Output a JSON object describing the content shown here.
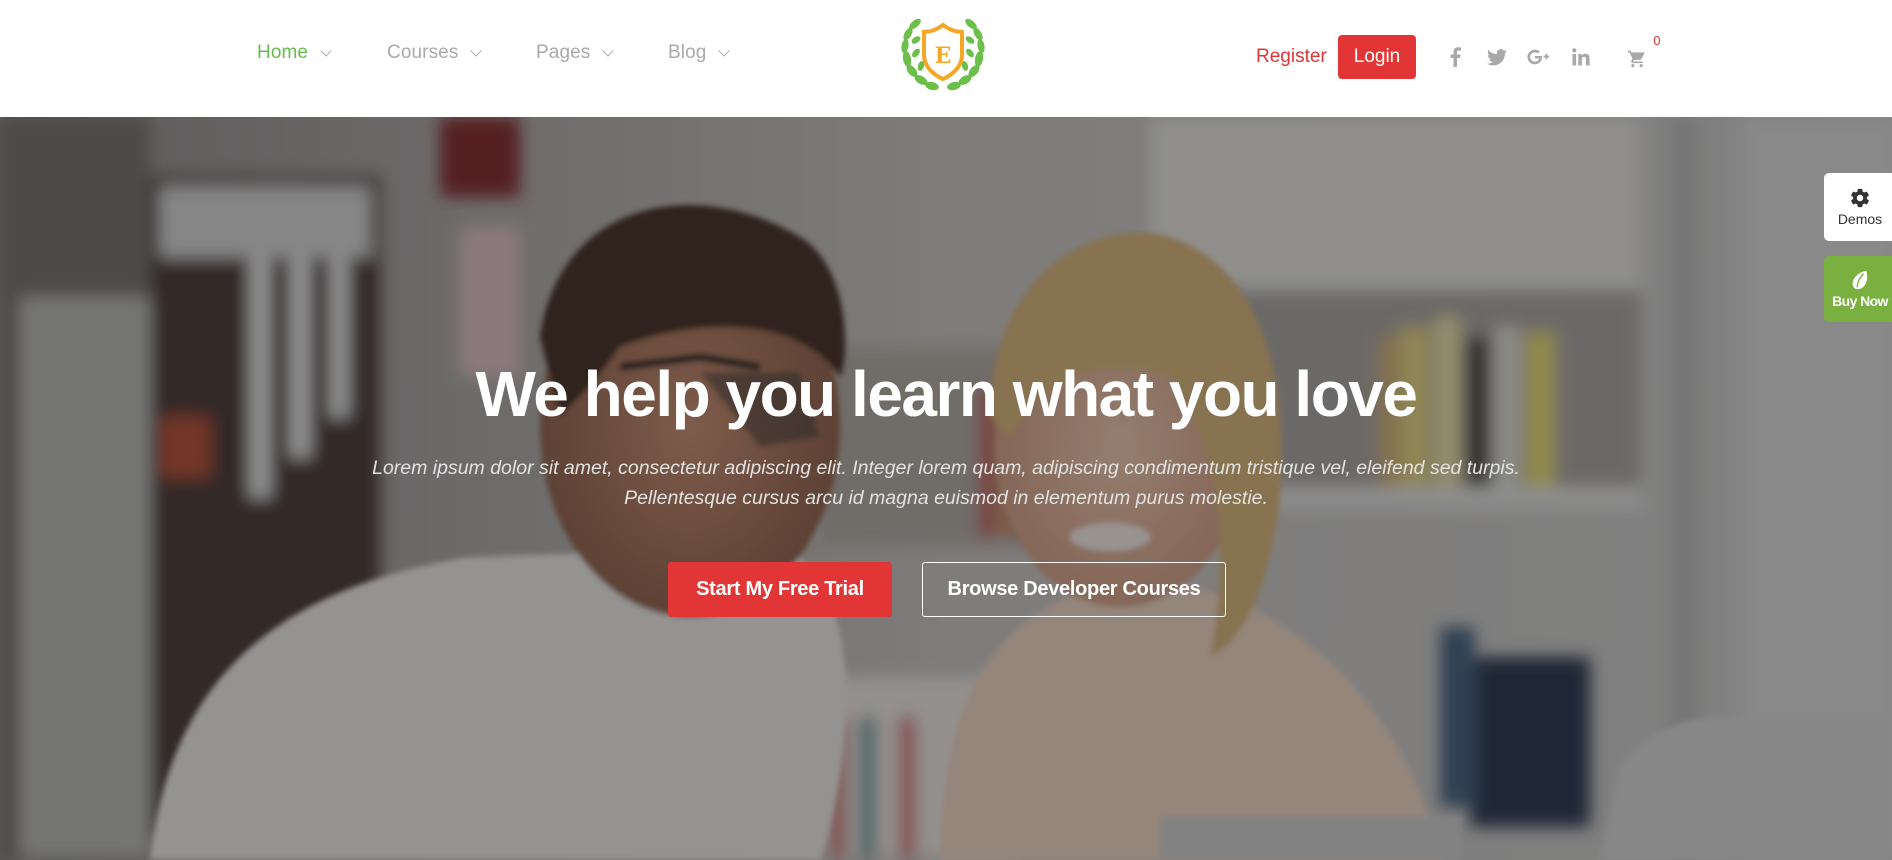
{
  "header": {
    "nav": [
      {
        "label": "Home",
        "active": true
      },
      {
        "label": "Courses",
        "active": false
      },
      {
        "label": "Pages",
        "active": false
      },
      {
        "label": "Blog",
        "active": false
      }
    ],
    "logo": {
      "letter": "E",
      "icon": "laurel-shield-logo"
    },
    "register_label": "Register",
    "login_label": "Login",
    "social": [
      {
        "icon": "facebook-icon",
        "glyph": "f"
      },
      {
        "icon": "twitter-icon",
        "glyph": "🐦"
      },
      {
        "icon": "google-plus-icon",
        "glyph": "G+"
      },
      {
        "icon": "linkedin-icon",
        "glyph": "in"
      }
    ],
    "cart": {
      "icon": "cart-icon",
      "count": "0"
    }
  },
  "hero": {
    "title": "We help you learn what you love",
    "subtitle_line1": "Lorem ipsum dolor sit amet, consectetur adipiscing elit. Integer lorem quam, adipiscing condimentum tristique vel, eleifend sed turpis.",
    "subtitle_line2": "Pellentesque cursus arcu id magna euismod in elementum purus molestie.",
    "primary_button": "Start My Free Trial",
    "secondary_button": "Browse Developer Courses"
  },
  "side": {
    "demos_label": "Demos",
    "buy_label": "Buy Now"
  },
  "colors": {
    "accent_red": "#e23535",
    "nav_active_green": "#66bb4a",
    "nav_gray": "#a9a9a9",
    "buy_green": "#7ab03f",
    "logo_gold": "#f5a623"
  }
}
